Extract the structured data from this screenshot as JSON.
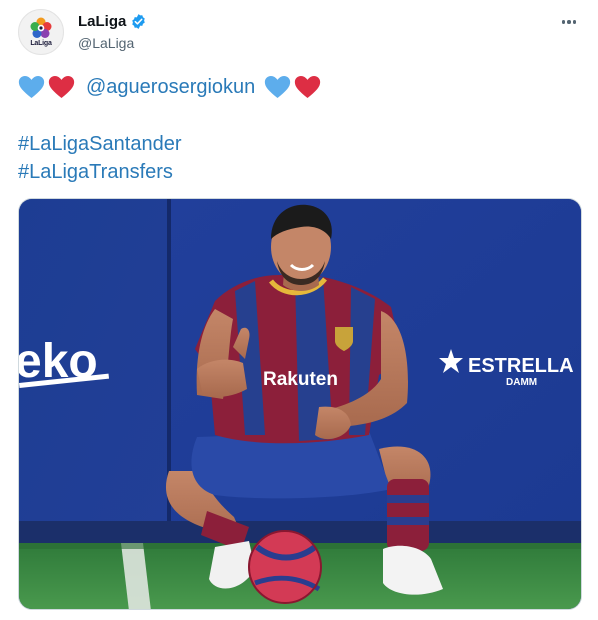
{
  "account": {
    "avatar_text": "LaLiga",
    "display_name": "LaLiga",
    "handle": "@LaLiga",
    "verified_icon": "verified-badge-icon"
  },
  "header": {
    "more_icon": "more-options-icon"
  },
  "tweet": {
    "mention": "@aguerosergiokun",
    "hashtags": [
      "#LaLigaSantander",
      "#LaLigaTransfers"
    ],
    "emoji": [
      "blue-heart",
      "red-heart",
      "blue-heart",
      "red-heart"
    ]
  },
  "photo": {
    "left_banner_text": "eko",
    "sponsor_text": "ESTRELLA",
    "sponsor_subtext": "DAMM",
    "shirt_text": "Rakuten"
  },
  "colors": {
    "link": "#2a7ab8",
    "verified": "#1d9bf0",
    "blue_heart": "#5dadec",
    "red_heart": "#dd2e44",
    "board_blue": "#1f3f9a",
    "grass": "#3f8f45"
  }
}
